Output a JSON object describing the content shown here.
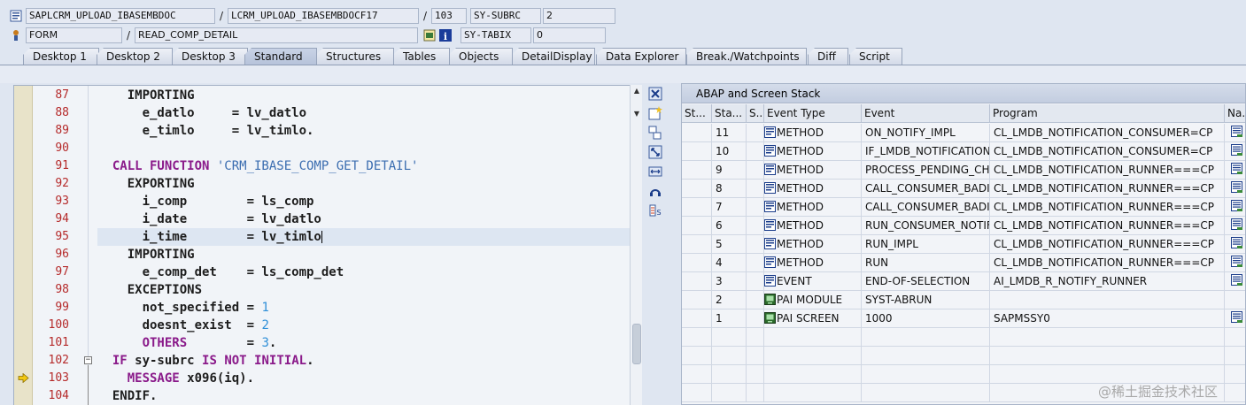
{
  "header": {
    "row1": {
      "program": "SAPLCRM_UPLOAD_IBASEMBDOC",
      "include": "LCRM_UPLOAD_IBASEMBDOCF17",
      "line": "103",
      "sysfield_label": "SY-SUBRC",
      "sysfield_value": "2"
    },
    "row2": {
      "event_type": "FORM",
      "event_name": "READ_COMP_DETAIL",
      "sysfield_label": "SY-TABIX",
      "sysfield_value": "0"
    },
    "separator": "/"
  },
  "tabs": [
    {
      "label": "Desktop 1"
    },
    {
      "label": "Desktop 2"
    },
    {
      "label": "Desktop 3"
    },
    {
      "label": "Standard"
    },
    {
      "label": "Structures"
    },
    {
      "label": "Tables"
    },
    {
      "label": "Objects"
    },
    {
      "label": "DetailDisplay"
    },
    {
      "label": "Data Explorer"
    },
    {
      "label": "Break./Watchpoints"
    },
    {
      "label": "Diff"
    },
    {
      "label": "Script"
    }
  ],
  "active_tab": "Standard",
  "code": {
    "lines": [
      {
        "num": "87",
        "text": "    IMPORTING"
      },
      {
        "num": "88",
        "text": "      e_datlo     = lv_datlo"
      },
      {
        "num": "89",
        "text": "      e_timlo     = lv_timlo."
      },
      {
        "num": "90",
        "text": ""
      },
      {
        "num": "91",
        "text": "  CALL FUNCTION 'CRM_IBASE_COMP_GET_DETAIL'"
      },
      {
        "num": "92",
        "text": "    EXPORTING"
      },
      {
        "num": "93",
        "text": "      i_comp        = ls_comp"
      },
      {
        "num": "94",
        "text": "      i_date        = lv_datlo"
      },
      {
        "num": "95",
        "text": "      i_time        = lv_timlo"
      },
      {
        "num": "96",
        "text": "    IMPORTING"
      },
      {
        "num": "97",
        "text": "      e_comp_det    = ls_comp_det"
      },
      {
        "num": "98",
        "text": "    EXCEPTIONS"
      },
      {
        "num": "99",
        "text": "      not_specified = 1"
      },
      {
        "num": "100",
        "text": "      doesnt_exist  = 2"
      },
      {
        "num": "101",
        "text": "      OTHERS        = 3."
      },
      {
        "num": "102",
        "text": "  IF sy-subrc IS NOT INITIAL."
      },
      {
        "num": "103",
        "text": "    MESSAGE x096(iq)."
      },
      {
        "num": "104",
        "text": "  ENDIF."
      }
    ],
    "current_line": "103",
    "cursor_line": "95"
  },
  "stack": {
    "title": "ABAP and Screen Stack",
    "columns": [
      "St...",
      "Sta...",
      "S...",
      "Event Type",
      "Event",
      "Program",
      "Na..."
    ],
    "rows": [
      {
        "level": "11",
        "type": "METHOD",
        "event": "ON_NOTIFY_IMPL",
        "program": "CL_LMDB_NOTIFICATION_CONSUMER=CP",
        "icon": "method-icon",
        "nav": true
      },
      {
        "level": "10",
        "type": "METHOD",
        "event": "IF_LMDB_NOTIFICATION...",
        "program": "CL_LMDB_NOTIFICATION_CONSUMER=CP",
        "icon": "method-icon",
        "nav": true
      },
      {
        "level": "9",
        "type": "METHOD",
        "event": "PROCESS_PENDING_CHA...",
        "program": "CL_LMDB_NOTIFICATION_RUNNER===CP",
        "icon": "method-icon",
        "nav": true
      },
      {
        "level": "8",
        "type": "METHOD",
        "event": "CALL_CONSUMER_BADIS...",
        "program": "CL_LMDB_NOTIFICATION_RUNNER===CP",
        "icon": "method-icon",
        "nav": true
      },
      {
        "level": "7",
        "type": "METHOD",
        "event": "CALL_CONSUMER_BADIS",
        "program": "CL_LMDB_NOTIFICATION_RUNNER===CP",
        "icon": "method-icon",
        "nav": true
      },
      {
        "level": "6",
        "type": "METHOD",
        "event": "RUN_CONSUMER_NOTIFI...",
        "program": "CL_LMDB_NOTIFICATION_RUNNER===CP",
        "icon": "method-icon",
        "nav": true
      },
      {
        "level": "5",
        "type": "METHOD",
        "event": "RUN_IMPL",
        "program": "CL_LMDB_NOTIFICATION_RUNNER===CP",
        "icon": "method-icon",
        "nav": true
      },
      {
        "level": "4",
        "type": "METHOD",
        "event": "RUN",
        "program": "CL_LMDB_NOTIFICATION_RUNNER===CP",
        "icon": "method-icon",
        "nav": true
      },
      {
        "level": "3",
        "type": "EVENT",
        "event": "END-OF-SELECTION",
        "program": "AI_LMDB_R_NOTIFY_RUNNER",
        "icon": "event-icon",
        "nav": true
      },
      {
        "level": "2",
        "type": "PAI MODULE",
        "event": "SYST-ABRUN",
        "program": "",
        "icon": "screen-icon",
        "nav": false
      },
      {
        "level": "1",
        "type": "PAI SCREEN",
        "event": "1000",
        "program": "SAPMSSY0",
        "icon": "screen-icon",
        "nav": true
      }
    ]
  },
  "watermark": "@稀土掘金技术社区",
  "colors": {
    "keyword": "#8a1a8a",
    "string": "#3b6db0",
    "number": "#2f8fd8",
    "line_number": "#b52a2a",
    "background": "#dfe6f1"
  }
}
